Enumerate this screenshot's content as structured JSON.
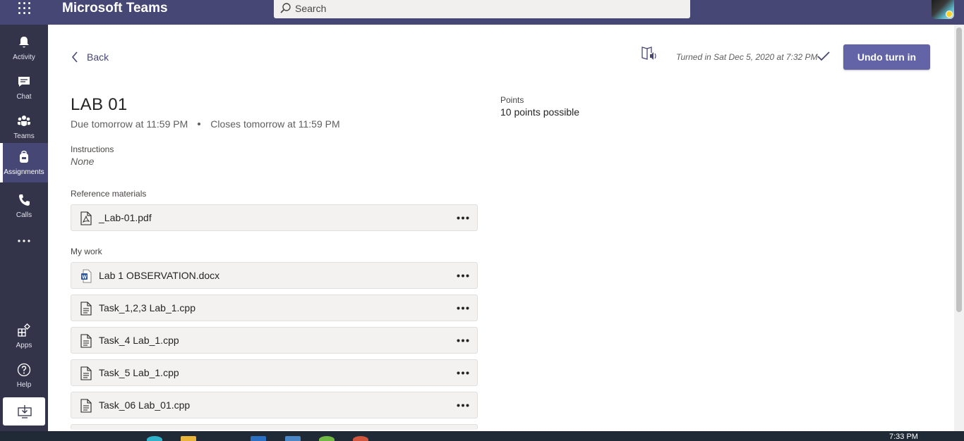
{
  "app": {
    "title": "Microsoft Teams"
  },
  "search": {
    "placeholder": "Search"
  },
  "rail": {
    "items": [
      {
        "label": "Activity"
      },
      {
        "label": "Chat"
      },
      {
        "label": "Teams"
      },
      {
        "label": "Assignments"
      },
      {
        "label": "Calls"
      },
      {
        "label": "Apps"
      },
      {
        "label": "Help"
      }
    ]
  },
  "assignment": {
    "back_label": "Back",
    "status_text": "Turned in Sat Dec 5, 2020 at 7:32 PM",
    "undo_label": "Undo turn in",
    "title": "LAB 01",
    "due": "Due tomorrow at 11:59 PM",
    "closes": "Closes tomorrow at 11:59 PM",
    "instructions_label": "Instructions",
    "instructions_value": "None",
    "points_label": "Points",
    "points_value": "10 points possible",
    "reference_label": "Reference materials",
    "reference_files": [
      {
        "name": "_Lab-01.pdf",
        "icon": "pdf-file-icon"
      }
    ],
    "my_work_label": "My work",
    "my_work_files": [
      {
        "name": "Lab 1 OBSERVATION.docx",
        "icon": "word-file-icon"
      },
      {
        "name": "Task_1,2,3 Lab_1.cpp",
        "icon": "code-file-icon"
      },
      {
        "name": "Task_4 Lab_1.cpp",
        "icon": "code-file-icon"
      },
      {
        "name": "Task_5 Lab_1.cpp",
        "icon": "code-file-icon"
      },
      {
        "name": "Task_06 Lab_01.cpp",
        "icon": "code-file-icon"
      }
    ]
  },
  "taskbar": {
    "time": "7:33 PM"
  },
  "colors": {
    "brand": "#464775",
    "rail": "#33344a",
    "accent": "#6264a7"
  }
}
